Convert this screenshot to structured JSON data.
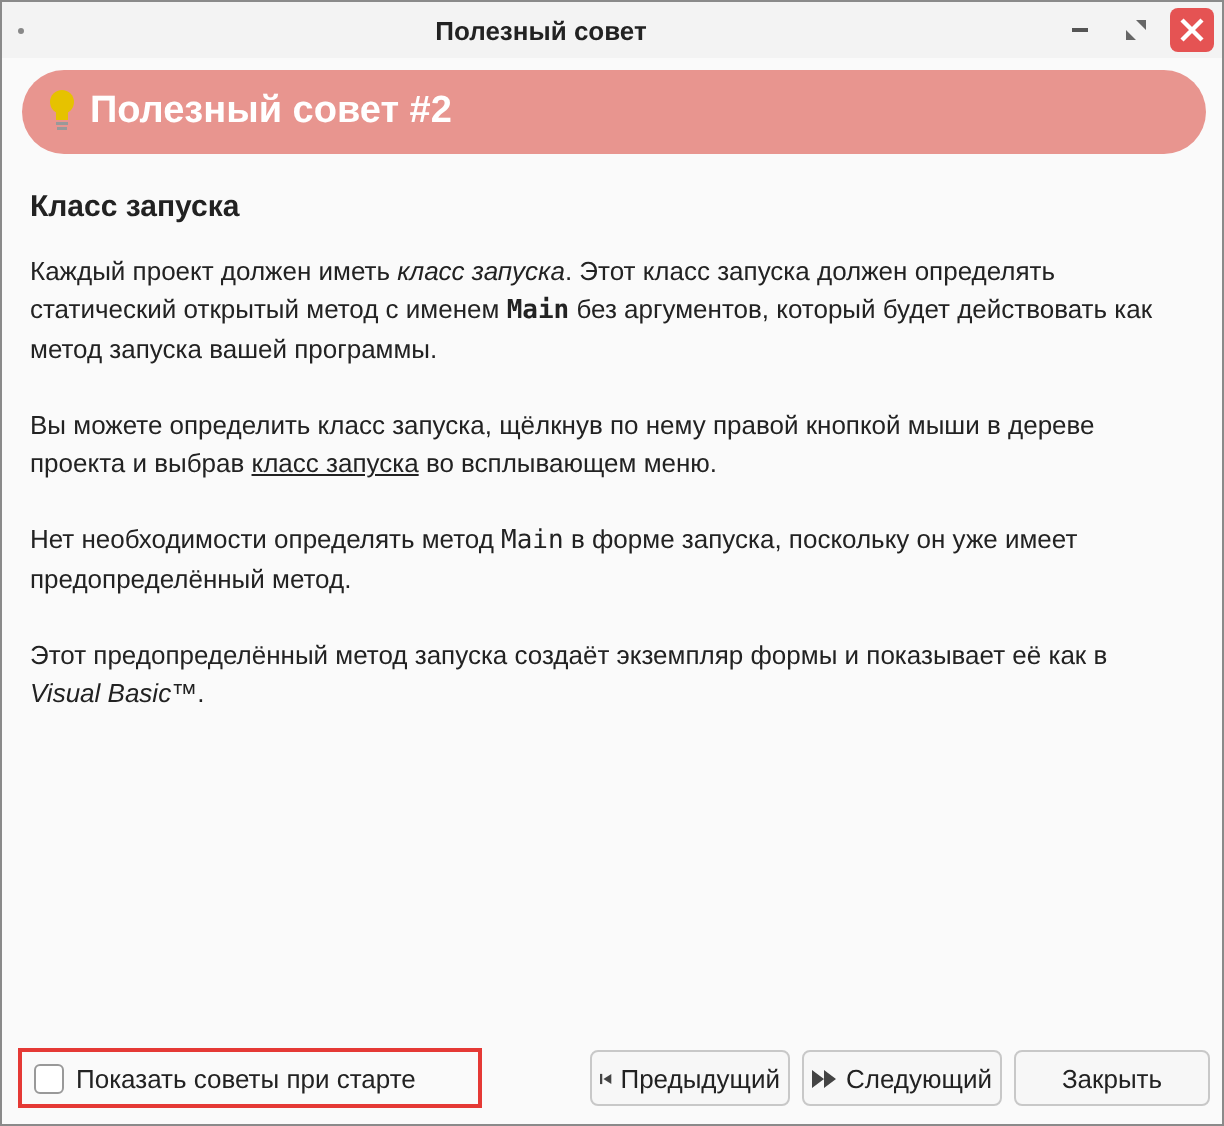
{
  "window": {
    "title": "Полезный совет"
  },
  "banner": {
    "title": "Полезный совет #2"
  },
  "heading": "Класс запуска",
  "paragraphs": [
    [
      {
        "kind": "text",
        "text": "Каждый проект должен иметь "
      },
      {
        "kind": "italic",
        "text": "класс запуска"
      },
      {
        "kind": "text",
        "text": ". Этот класс запуска должен определять статический открытый метод с именем "
      },
      {
        "kind": "code_bold",
        "text": "Main"
      },
      {
        "kind": "text",
        "text": " без аргументов, который будет действовать как метод запуска вашей программы."
      }
    ],
    [
      {
        "kind": "text",
        "text": "Вы можете определить класс запуска, щёлкнув по нему правой кнопкой мыши в дереве проекта и выбрав "
      },
      {
        "kind": "link",
        "text": "класс запуска"
      },
      {
        "kind": "text",
        "text": " во всплывающем меню."
      }
    ],
    [
      {
        "kind": "text",
        "text": "Нет необходимости определять метод "
      },
      {
        "kind": "code",
        "text": "Main"
      },
      {
        "kind": "text",
        "text": " в форме запуска, поскольку он уже имеет предопределённый метод."
      }
    ],
    [
      {
        "kind": "text",
        "text": "Этот предопределённый метод запуска создаёт экземпляр формы и показывает её как в "
      },
      {
        "kind": "italic",
        "text": "Visual Basic"
      },
      {
        "kind": "text",
        "text": "™."
      }
    ]
  ],
  "show_on_startup": {
    "label": "Показать советы при старте",
    "checked": false,
    "highlighted": true
  },
  "buttons": [
    {
      "kind": "previous",
      "label": "Предыдущий"
    },
    {
      "kind": "next",
      "label": "Следующий"
    },
    {
      "kind": "close",
      "label": "Закрыть"
    }
  ]
}
